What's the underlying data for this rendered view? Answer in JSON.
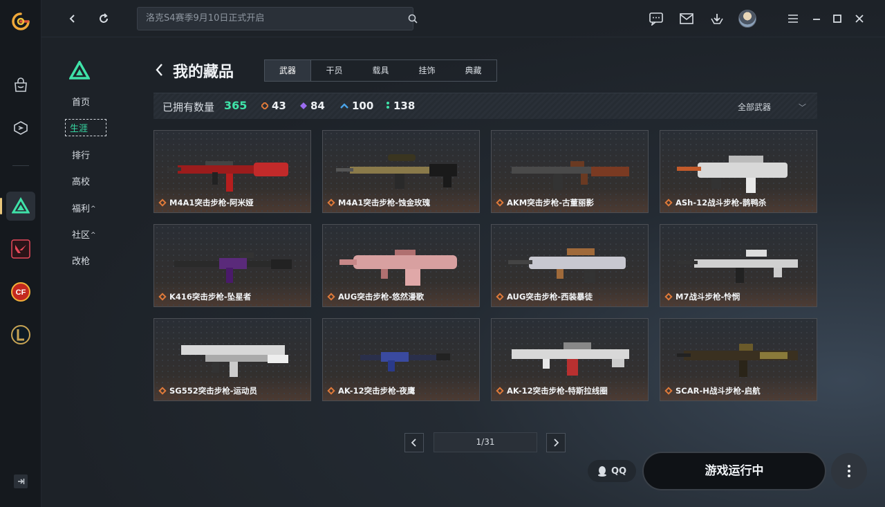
{
  "search": {
    "placeholder": "洛克S4赛季9月10日正式开启"
  },
  "subnav": {
    "items": [
      {
        "label": "首页"
      },
      {
        "label": "生涯"
      },
      {
        "label": "排行"
      },
      {
        "label": "高校"
      },
      {
        "label": "福利",
        "caret": "^"
      },
      {
        "label": "社区",
        "caret": "^"
      },
      {
        "label": "改枪"
      }
    ]
  },
  "header": {
    "title": "我的藏品"
  },
  "tabs": [
    "武器",
    "干员",
    "载具",
    "挂饰",
    "典藏"
  ],
  "stats": {
    "own_label": "已拥有数量",
    "own_value": "365",
    "orange": "43",
    "purple": "84",
    "blue": "100",
    "green": "138",
    "filter_label": "全部武器"
  },
  "colors": {
    "accent": "#3fe2a8",
    "rarity_orange": "#e07a3a",
    "rarity_purple": "#9b6cf0",
    "rarity_blue": "#4aa3e8",
    "rarity_green": "#3fe2a8"
  },
  "cards": [
    {
      "name": "M4A1突击步枪-阿米娅"
    },
    {
      "name": "M4A1突击步枪-蚀金玫瑰"
    },
    {
      "name": "AKM突击步枪-古董丽影"
    },
    {
      "name": "ASh-12战斗步枪-鹊鸭杀"
    },
    {
      "name": "K416突击步枪-坠星者"
    },
    {
      "name": "AUG突击步枪-悠然漫歌"
    },
    {
      "name": "AUG突击步枪-西装暴徒"
    },
    {
      "name": "M7战斗步枪-怜悯"
    },
    {
      "name": "SG552突击步枪-运动员"
    },
    {
      "name": "AK-12突击步枪-夜鹰"
    },
    {
      "name": "AK-12突击步枪-特斯拉线圈"
    },
    {
      "name": "SCAR-H战斗步枪-启航"
    }
  ],
  "pager": {
    "text": "1/31"
  },
  "bottom": {
    "qq_label": "QQ",
    "launch_label": "游戏运行中"
  }
}
